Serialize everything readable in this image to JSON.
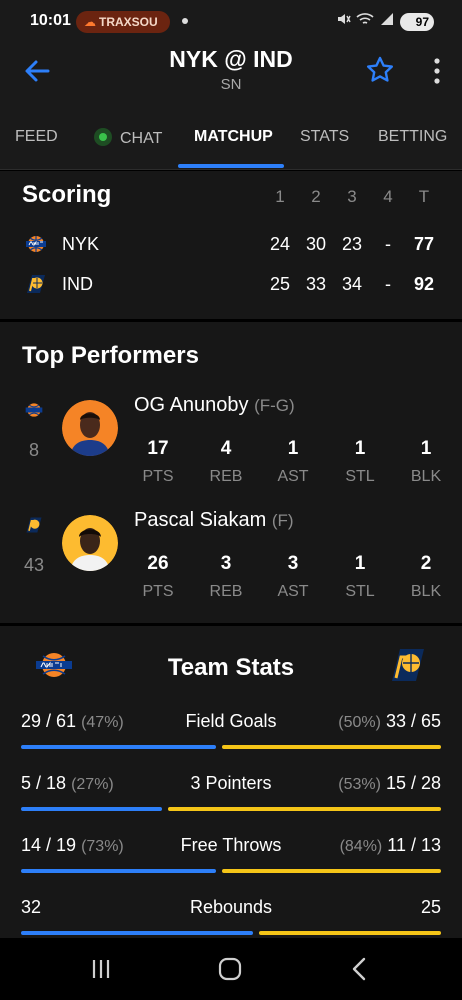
{
  "status_bar": {
    "time": "10:01",
    "app_pill": "TRAXSOU",
    "battery": "97",
    "icons": [
      "mute-icon",
      "wifi-icon",
      "signal-icon"
    ]
  },
  "header": {
    "title": "NYK @ IND",
    "subtitle": "SN",
    "icons": [
      "back-arrow-icon",
      "star-icon",
      "more-vert-icon"
    ]
  },
  "tabs": [
    {
      "label": "FEED",
      "active": false
    },
    {
      "label": "CHAT",
      "active": false,
      "live_dot": true
    },
    {
      "label": "MATCHUP",
      "active": true
    },
    {
      "label": "STATS",
      "active": false
    },
    {
      "label": "BETTING",
      "active": false
    }
  ],
  "scoring": {
    "title": "Scoring",
    "periods": [
      "1",
      "2",
      "3",
      "4",
      "T"
    ],
    "teams": [
      {
        "abbr": "NYK",
        "scores": [
          "24",
          "30",
          "23",
          "-"
        ],
        "total": "77"
      },
      {
        "abbr": "IND",
        "scores": [
          "25",
          "33",
          "34",
          "-"
        ],
        "total": "92"
      }
    ]
  },
  "top_performers": {
    "title": "Top Performers",
    "players": [
      {
        "team": "NYK",
        "jersey": "8",
        "name": "OG Anunoby",
        "position": "(F-G)",
        "stats": [
          {
            "value": "17",
            "label": "PTS"
          },
          {
            "value": "4",
            "label": "REB"
          },
          {
            "value": "1",
            "label": "AST"
          },
          {
            "value": "1",
            "label": "STL"
          },
          {
            "value": "1",
            "label": "BLK"
          }
        ]
      },
      {
        "team": "IND",
        "jersey": "43",
        "name": "Pascal Siakam",
        "position": "(F)",
        "stats": [
          {
            "value": "26",
            "label": "PTS"
          },
          {
            "value": "3",
            "label": "REB"
          },
          {
            "value": "3",
            "label": "AST"
          },
          {
            "value": "1",
            "label": "STL"
          },
          {
            "value": "2",
            "label": "BLK"
          }
        ]
      }
    ]
  },
  "team_stats": {
    "title": "Team Stats",
    "colors": {
      "away": "#2d7ff9",
      "home": "#f5c518"
    },
    "rows": [
      {
        "label": "Field Goals",
        "away": "29 / 61",
        "away_pct": "(47%)",
        "home": "33 / 65",
        "home_pct": "(50%)",
        "away_share": 0.47
      },
      {
        "label": "3 Pointers",
        "away": "5 / 18",
        "away_pct": "(27%)",
        "home": "15 / 28",
        "home_pct": "(53%)",
        "away_share": 0.34
      },
      {
        "label": "Free Throws",
        "away": "14 / 19",
        "away_pct": "(73%)",
        "home": "11 / 13",
        "home_pct": "(84%)",
        "away_share": 0.47
      },
      {
        "label": "Rebounds",
        "away": "32",
        "away_pct": "",
        "home": "25",
        "home_pct": "",
        "away_share": 0.56
      }
    ]
  },
  "nav_bar": {
    "icons": [
      "recents-icon",
      "home-icon",
      "back-icon"
    ]
  }
}
